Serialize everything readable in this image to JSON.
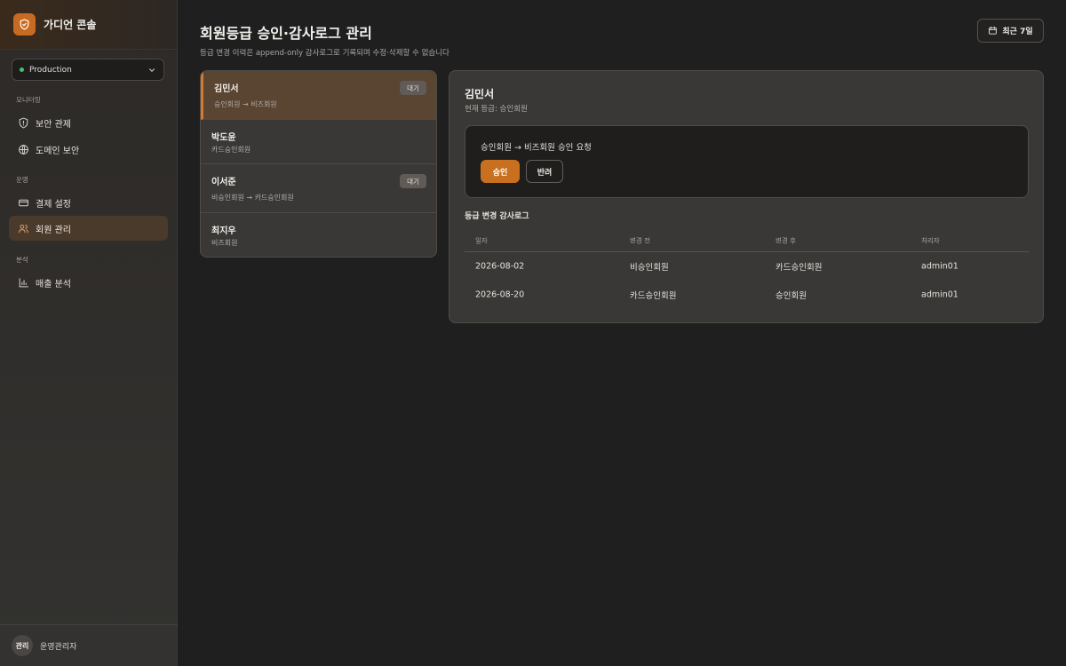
{
  "app": {
    "title": "가디언 콘솔",
    "environment": "Production"
  },
  "sidebar": {
    "sections": [
      {
        "label": "모니터링"
      },
      {
        "label": "운영"
      },
      {
        "label": "분석"
      }
    ],
    "items": [
      {
        "label": "보안 관제",
        "icon": "shield-icon"
      },
      {
        "label": "도메인 보안",
        "icon": "globe-icon"
      },
      {
        "label": "결제 설정",
        "icon": "credit-card-icon"
      },
      {
        "label": "회원 관리",
        "icon": "users-icon",
        "active": true
      },
      {
        "label": "매출 분석",
        "icon": "bar-chart-icon"
      }
    ],
    "footer": {
      "avatar": "관리",
      "user": "운영관리자"
    }
  },
  "header": {
    "title": "회원등급 승인·감사로그 관리",
    "subtitle": "등급 변경 이력은 append-only 감사로그로 기록되며 수정·삭제할 수 없습니다",
    "date_filter": "최근 7일"
  },
  "members": [
    {
      "name": "김민서",
      "desc": "승인회원 → 비즈회원",
      "badge": "대기"
    },
    {
      "name": "박도윤",
      "desc": "카드승인회원"
    },
    {
      "name": "이서준",
      "desc": "비승인회원 → 카드승인회원",
      "badge": "대기"
    },
    {
      "name": "최지우",
      "desc": "비즈회원"
    }
  ],
  "detail": {
    "name": "김민서",
    "current_grade": "현재 등급: 승인회원",
    "request": "승인회원 → 비즈회원 승인 요청",
    "approve_label": "승인",
    "reject_label": "반려",
    "log_title": "등급 변경 감사로그",
    "log_columns": [
      "일자",
      "변경 전",
      "변경 후",
      "처리자"
    ],
    "log_rows": [
      [
        "2026-08-02",
        "비승인회원",
        "카드승인회원",
        "admin01"
      ],
      [
        "2026-08-20",
        "카드승인회원",
        "승인회원",
        "admin01"
      ]
    ]
  },
  "colors": {
    "accent": "#c8701f",
    "active_nav": "#4a3a2c",
    "status_dot": "#3ec46d"
  }
}
